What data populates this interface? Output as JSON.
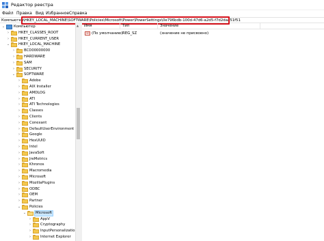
{
  "window": {
    "title": "Редактор реестра"
  },
  "menu": [
    "Файл",
    "Правка",
    "Вид",
    "Избранное",
    "Справка"
  ],
  "address": {
    "prefix": "Компьютер",
    "path": "\\HKEY_LOCAL_MACHINE\\SOFTWARE\\Policies\\Microsoft\\Power\\PowerSettings\\0e796bdb-100d-47d6-a2d5-f7d2daa51f51"
  },
  "tree": [
    {
      "label": "Компьютер",
      "expanded": true,
      "icon": "computer-icon"
    },
    {
      "label": "HKEY_CLASSES_ROOT",
      "expanded": false,
      "icon": "folder-icon"
    },
    {
      "label": "HKEY_CURRENT_USER",
      "expanded": false,
      "icon": "folder-icon"
    },
    {
      "label": "HKEY_LOCAL_MACHINE",
      "expanded": true,
      "icon": "folder-icon"
    },
    {
      "label": "BCD00000000",
      "expanded": false,
      "icon": "folder-icon"
    },
    {
      "label": "HARDWARE",
      "expanded": false,
      "icon": "folder-icon"
    },
    {
      "label": "SAM",
      "expanded": false,
      "icon": "folder-icon"
    },
    {
      "label": "SECURITY",
      "expanded": false,
      "icon": "folder-icon"
    },
    {
      "label": "SOFTWARE",
      "expanded": true,
      "icon": "folder-icon"
    },
    {
      "label": "Adobe",
      "expanded": false,
      "icon": "folder-icon"
    },
    {
      "label": "AIX Installer",
      "expanded": false,
      "icon": "folder-icon"
    },
    {
      "label": "AMDLOG",
      "expanded": false,
      "icon": "folder-icon"
    },
    {
      "label": "ATI",
      "expanded": false,
      "icon": "folder-icon"
    },
    {
      "label": "ATI Technologies",
      "expanded": false,
      "icon": "folder-icon"
    },
    {
      "label": "Classes",
      "expanded": false,
      "icon": "folder-icon"
    },
    {
      "label": "Clients",
      "expanded": false,
      "icon": "folder-icon"
    },
    {
      "label": "Conexant",
      "expanded": false,
      "icon": "folder-icon"
    },
    {
      "label": "DefaultUserEnvironment",
      "expanded": false,
      "icon": "folder-icon"
    },
    {
      "label": "Google",
      "expanded": false,
      "icon": "folder-icon"
    },
    {
      "label": "HexUUID",
      "expanded": false,
      "icon": "folder-icon"
    },
    {
      "label": "Intel",
      "expanded": false,
      "icon": "folder-icon"
    },
    {
      "label": "JavaSoft",
      "expanded": false,
      "icon": "folder-icon"
    },
    {
      "label": "JreMetrics",
      "expanded": false,
      "icon": "folder-icon"
    },
    {
      "label": "Khronos",
      "expanded": false,
      "icon": "folder-icon"
    },
    {
      "label": "Macromedia",
      "expanded": false,
      "icon": "folder-icon"
    },
    {
      "label": "Microsoft",
      "expanded": false,
      "icon": "folder-icon"
    },
    {
      "label": "MozillaPlugins",
      "expanded": false,
      "icon": "folder-icon"
    },
    {
      "label": "ODBC",
      "expanded": false,
      "icon": "folder-icon"
    },
    {
      "label": "OEM",
      "expanded": false,
      "icon": "folder-icon"
    },
    {
      "label": "Partner",
      "expanded": false,
      "icon": "folder-icon"
    },
    {
      "label": "Policies",
      "expanded": true,
      "icon": "folder-icon"
    },
    {
      "label": "Microsoft",
      "expanded": true,
      "icon": "folder-open-icon",
      "selected": true
    },
    {
      "label": "AppV",
      "expanded": false,
      "icon": "folder-icon"
    },
    {
      "label": "Cryptography",
      "expanded": false,
      "icon": "folder-icon"
    },
    {
      "label": "InputPersonalization",
      "expanded": false,
      "icon": "folder-icon"
    },
    {
      "label": "Internet Explorer",
      "expanded": false,
      "icon": "folder-icon"
    }
  ],
  "values_table": {
    "headers": [
      "Имя",
      "Тип",
      "Значение"
    ],
    "rows": [
      {
        "name": "(По умолчанию)",
        "type": "REG_SZ",
        "value": "(значение не присвоено)",
        "icon": "ab-string-icon"
      }
    ]
  },
  "colors": {
    "highlight_border": "#d4101a",
    "selection": "#cce8ff",
    "folder": "#f4c84e"
  }
}
